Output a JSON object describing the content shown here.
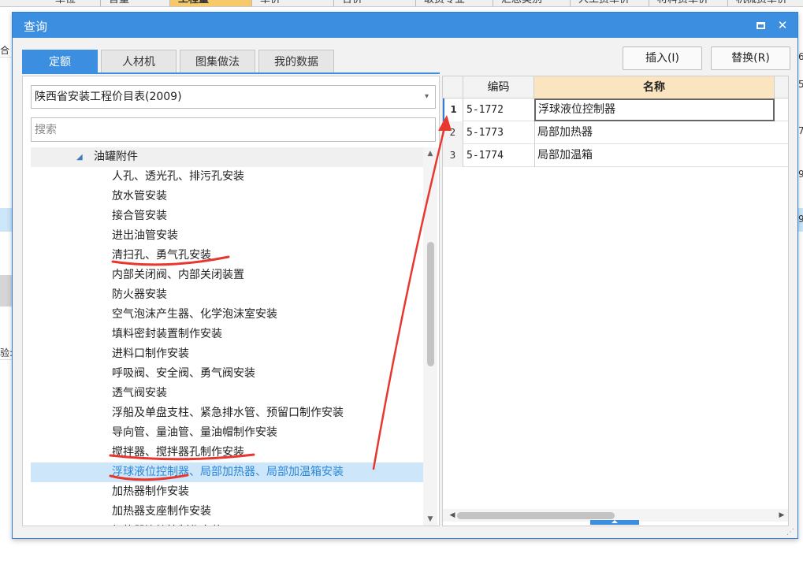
{
  "background": {
    "header_cells": [
      {
        "label": "单位",
        "highlight": false
      },
      {
        "label": "含量",
        "highlight": false
      },
      {
        "label": "工程量",
        "highlight": true
      },
      {
        "label": "单价",
        "highlight": false
      },
      {
        "label": "合价",
        "highlight": false
      },
      {
        "label": "取费专业",
        "highlight": false
      },
      {
        "label": "汇总类别",
        "highlight": false
      },
      {
        "label": "人工费单价",
        "highlight": false
      },
      {
        "label": "材料费单价",
        "highlight": false
      },
      {
        "label": "机械费单价",
        "highlight": false
      }
    ],
    "left_marks": [
      "合",
      "",
      "",
      "",
      "验:"
    ],
    "right_marks": [
      "6",
      "5",
      "7",
      "9",
      "9"
    ]
  },
  "dialog": {
    "title": "查询",
    "tabs": [
      {
        "label": "定额",
        "active": true
      },
      {
        "label": "人材机",
        "active": false
      },
      {
        "label": "图集做法",
        "active": false
      },
      {
        "label": "我的数据",
        "active": false
      }
    ],
    "buttons": {
      "insert": "插入(I)",
      "replace": "替换(R)"
    },
    "library_select": "陕西省安装工程价目表(2009)",
    "search_placeholder": "搜索",
    "tree": {
      "parent": "油罐附件",
      "children": [
        "人孔、透光孔、排污孔安装",
        "放水管安装",
        "接合管安装",
        "进出油管安装",
        "清扫孔、勇气孔安装",
        "内部关闭阀、内部关闭装置",
        "防火器安装",
        "空气泡沫产生器、化学泡沫室安装",
        "填料密封装置制作安装",
        "进料口制作安装",
        "呼吸阀、安全阀、勇气阀安装",
        "透气阀安装",
        "浮船及单盘支柱、紧急排水管、预留口制作安装",
        "导向管、量油管、量油帽制作安装",
        "搅拌器、搅拌器孔制作安装",
        "浮球液位控制器、局部加热器、局部加温箱安装",
        "加热器制作安装",
        "加热器支座制作安装",
        "加热器连接管制作安装"
      ],
      "selected_index": 15
    },
    "grid": {
      "columns": {
        "code": "编码",
        "name": "名称"
      },
      "rows": [
        {
          "index": "1",
          "code": "5-1772",
          "name": "浮球液位控制器"
        },
        {
          "index": "2",
          "code": "5-1773",
          "name": "局部加热器"
        },
        {
          "index": "3",
          "code": "5-1774",
          "name": "局部加温箱"
        }
      ]
    }
  },
  "colors": {
    "accent": "#3b8ee0",
    "annotation": "#e8372f",
    "highlight_col": "#fbe4c0",
    "selection": "#cde6f9"
  },
  "icons": [
    "maximize-icon",
    "close-icon",
    "dropdown-caret-icon",
    "tree-expand-icon",
    "scroll-up-icon",
    "scroll-down-icon",
    "scroll-left-icon",
    "scroll-right-icon",
    "resize-grip-icon"
  ]
}
